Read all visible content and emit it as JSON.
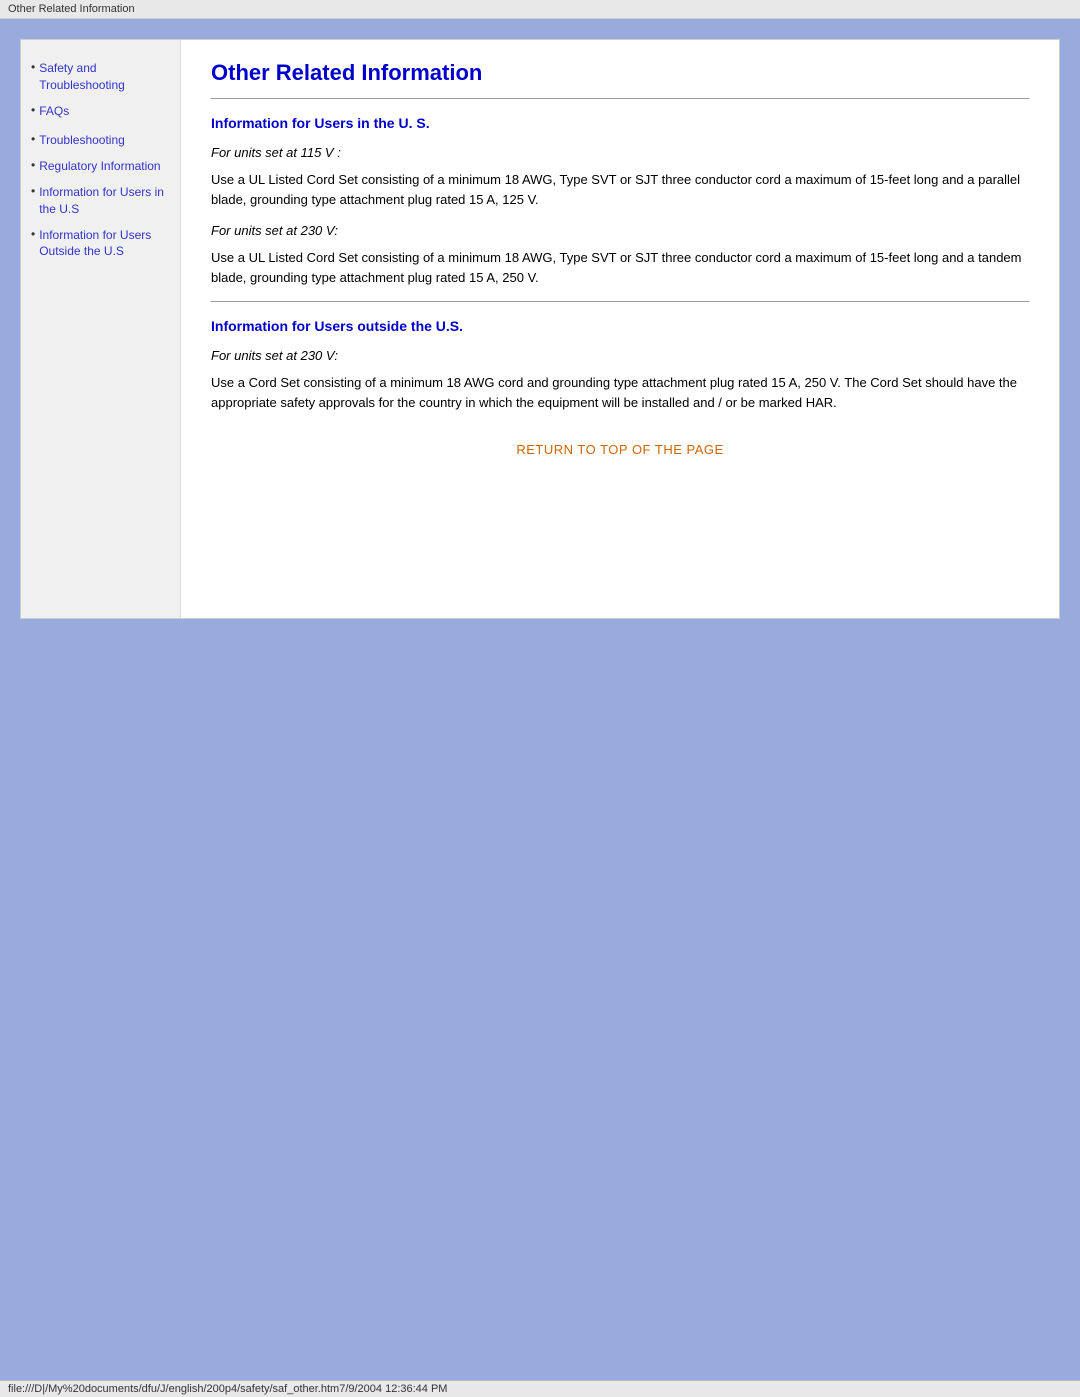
{
  "title_bar": {
    "text": "Other Related Information"
  },
  "status_bar": {
    "text": "file:///D|/My%20documents/dfu/J/english/200p4/safety/saf_other.htm7/9/2004 12:36:44 PM"
  },
  "sidebar": {
    "items": [
      {
        "label": "Safety and Troubleshooting",
        "href": "#"
      },
      {
        "label": "FAQs",
        "href": "#"
      },
      {
        "label": "Troubleshooting",
        "href": "#"
      },
      {
        "label": "Regulatory Information",
        "href": "#"
      },
      {
        "label": "Information for Users in the U.S",
        "href": "#"
      },
      {
        "label": "Information for Users Outside the U.S",
        "href": "#"
      }
    ]
  },
  "main": {
    "page_title": "Other Related Information",
    "section1": {
      "title": "Information for Users in the U. S.",
      "para1_italic": "For units set at 115 V :",
      "para1_text": "Use a UL Listed Cord Set consisting of a minimum 18 AWG, Type SVT or SJT three conductor cord a maximum of 15-feet long and a parallel blade, grounding type attachment plug rated 15 A, 125 V.",
      "para2_italic": "For units set at 230 V:",
      "para2_text": "Use a UL Listed Cord Set consisting of a minimum 18 AWG, Type SVT or SJT three conductor cord a maximum of 15-feet long and a tandem blade, grounding type attachment plug rated 15 A, 250 V."
    },
    "section2": {
      "title": "Information for Users outside the U.S.",
      "para1_italic": "For units set at 230 V:",
      "para1_text": "Use a Cord Set consisting of a minimum 18 AWG cord and grounding type attachment plug rated 15 A, 250 V. The Cord Set should have the appropriate safety approvals for the country in which the equipment will be installed and / or be marked HAR."
    },
    "return_link": "RETURN TO TOP OF THE PAGE"
  }
}
